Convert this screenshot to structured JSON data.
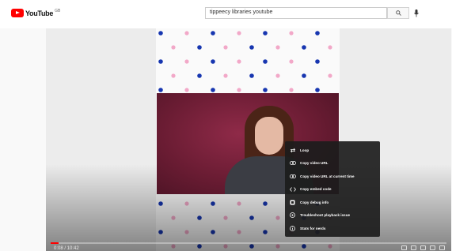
{
  "header": {
    "logo_text": "YouTube",
    "logo_region": "GB"
  },
  "search": {
    "query": "tippeecy libraries youtube"
  },
  "player": {
    "progress": 0.02,
    "time_display": "0:08 / 10:42",
    "context_menu": [
      {
        "label": "Loop",
        "icon": "loop-icon"
      },
      {
        "label": "Copy video URL",
        "icon": "link-icon"
      },
      {
        "label": "Copy video URL at current time",
        "icon": "link-icon"
      },
      {
        "label": "Copy embed code",
        "icon": "code-icon"
      },
      {
        "label": "Copy debug info",
        "icon": "debug-icon"
      },
      {
        "label": "Troubleshoot playback issue",
        "icon": "help-icon"
      },
      {
        "label": "Stats for nerds",
        "icon": "info-icon"
      }
    ]
  },
  "colors": {
    "brand_red": "#ff0000",
    "dot_blue": "#1736b0",
    "dot_pink": "#f2a8c8"
  }
}
